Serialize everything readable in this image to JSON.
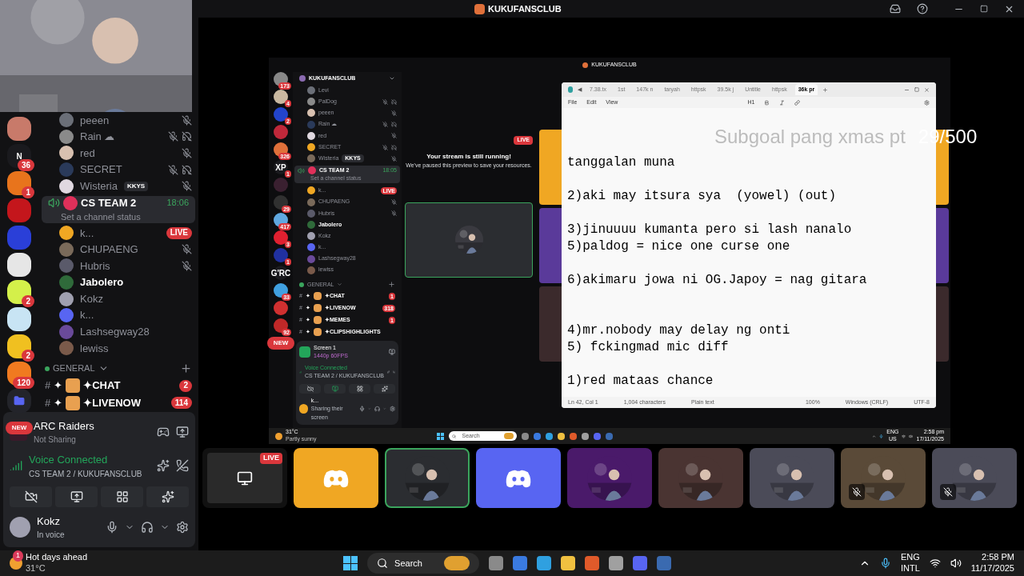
{
  "window": {
    "title": "KUKUFANSCLUB"
  },
  "outer": {
    "rail": [
      {
        "kind": "icon",
        "color": "#c87a6a"
      },
      {
        "kind": "text",
        "label": "N",
        "badge": "36"
      },
      {
        "kind": "icon",
        "color": "#e8741c",
        "badge": "1"
      },
      {
        "kind": "icon",
        "color": "#c4161c"
      },
      {
        "kind": "icon",
        "color": "#2a3fd8"
      },
      {
        "kind": "icon",
        "color": "#e6e6e6"
      },
      {
        "kind": "icon",
        "color": "#d4f04a",
        "badge": "2"
      },
      {
        "kind": "icon",
        "color": "#c8e4f4"
      },
      {
        "kind": "icon",
        "color": "#f0c020",
        "badge": "2"
      },
      {
        "kind": "icon",
        "color": "#f07a20",
        "badge": "120"
      },
      {
        "kind": "folder"
      },
      {
        "kind": "new",
        "label": "NEW"
      }
    ],
    "members_above": [
      {
        "name": "peeen",
        "muted": true,
        "deafened": false,
        "speaking": false,
        "live": false
      },
      {
        "name": "Rain ☁",
        "muted": true,
        "deafened": true,
        "speaking": false,
        "live": false
      },
      {
        "name": "red",
        "muted": true,
        "deafened": false,
        "speaking": false,
        "live": false
      },
      {
        "name": "SECRET",
        "muted": true,
        "deafened": true,
        "speaking": false,
        "live": false
      },
      {
        "name": "Wisteria",
        "tag": "KKYS",
        "muted": true,
        "deafened": false,
        "speaking": false,
        "live": false
      }
    ],
    "voice_channel": {
      "name": "CS TEAM 2",
      "timer": "18:06",
      "status": "Set a channel status"
    },
    "voice_members": [
      {
        "name": "k...",
        "muted": false,
        "deafened": false,
        "speaking": false,
        "live": true,
        "live_label": "LIVE"
      },
      {
        "name": "CHUPAENG",
        "muted": true,
        "deafened": false,
        "speaking": false,
        "live": false
      },
      {
        "name": "Hubris",
        "muted": true,
        "deafened": false,
        "speaking": false,
        "live": false
      },
      {
        "name": "Jabolero",
        "muted": false,
        "deafened": false,
        "speaking": true,
        "live": false
      },
      {
        "name": "Kokz",
        "muted": false,
        "deafened": false,
        "speaking": false,
        "live": false
      },
      {
        "name": "k...",
        "muted": false,
        "deafened": false,
        "speaking": false,
        "live": false
      },
      {
        "name": "Lashsegway28",
        "muted": false,
        "deafened": false,
        "speaking": false,
        "live": false
      },
      {
        "name": "lewiss",
        "muted": false,
        "deafened": false,
        "speaking": false,
        "live": false
      }
    ],
    "category": "GENERAL",
    "channels": [
      {
        "symbol": "#",
        "prefix": "✦",
        "name": "✦CHAT",
        "badge": "2"
      },
      {
        "symbol": "#",
        "prefix": "✦",
        "name": "✦LIVENOW",
        "badge": "114"
      }
    ],
    "activity": {
      "title": "ARC Raiders",
      "subtitle": "Not Sharing"
    },
    "voice": {
      "label": "Voice Connected",
      "channel": "CS TEAM 2 / KUKUFANSCLUB"
    },
    "user": {
      "name": "Kokz",
      "status": "In voice"
    }
  },
  "tiles": [
    {
      "kind": "stream",
      "live_label": "LIVE",
      "selected": false
    },
    {
      "kind": "discord",
      "color": "#f0a723",
      "selected": false
    },
    {
      "kind": "picture",
      "color": "#2b2d31",
      "selected": true
    },
    {
      "kind": "discord",
      "color": "#5865f2",
      "selected": false
    },
    {
      "kind": "picture",
      "color": "#4a1a6a",
      "selected": false
    },
    {
      "kind": "picture",
      "color": "#4a3432",
      "selected": false
    },
    {
      "kind": "picture",
      "color": "#4b4b58",
      "selected": false
    },
    {
      "kind": "picture",
      "color": "#5a4a38",
      "selected": false,
      "muted": true
    },
    {
      "kind": "picture",
      "color": "#4b4b58",
      "selected": false,
      "muted": true
    }
  ],
  "overlay": {
    "title": "Subgoal pang xmas pt",
    "count": "29/500"
  },
  "stream": {
    "title": "KUKUFANSCLUB",
    "nested": {
      "server": "KUKUFANSCLUB",
      "rail": [
        {
          "kind": "icon",
          "color": "#888888",
          "badge": "173"
        },
        {
          "kind": "icon",
          "color": "#c9b8a0",
          "badge": "4"
        },
        {
          "kind": "icon",
          "color": "#2244cc",
          "badge": "2"
        },
        {
          "kind": "icon",
          "color": "#c0283a"
        },
        {
          "kind": "icon",
          "color": "#e0703a",
          "badge": "326"
        },
        {
          "kind": "text",
          "label": "XP",
          "badge": "1"
        },
        {
          "kind": "icon",
          "color": "#3a2030"
        },
        {
          "kind": "icon",
          "color": "#303030",
          "badge": "29"
        },
        {
          "kind": "icon",
          "color": "#60a8e0",
          "badge": "417"
        },
        {
          "kind": "icon",
          "color": "#e02030",
          "badge": "3"
        },
        {
          "kind": "icon",
          "color": "#2030a0",
          "badge": "1"
        },
        {
          "kind": "text",
          "label": "G'RC"
        },
        {
          "kind": "icon",
          "color": "#40a0e0",
          "badge": "33"
        },
        {
          "kind": "icon",
          "color": "#d03030"
        },
        {
          "kind": "icon",
          "color": "#c02828",
          "badge": "92"
        },
        {
          "kind": "new",
          "label": "NEW"
        }
      ],
      "members_above": [
        {
          "name": "Levi",
          "muted": false,
          "deafened": false,
          "speaking": false,
          "live": false
        },
        {
          "name": "PalDog",
          "muted": true,
          "deafened": true,
          "speaking": false,
          "live": false
        },
        {
          "name": "peeen",
          "muted": true,
          "deafened": false,
          "speaking": false,
          "live": false
        },
        {
          "name": "Rain ☁",
          "muted": true,
          "deafened": true,
          "speaking": false,
          "live": false
        },
        {
          "name": "red",
          "muted": true,
          "deafened": false,
          "speaking": false,
          "live": false
        },
        {
          "name": "SECRET",
          "muted": true,
          "deafened": true,
          "speaking": false,
          "live": false
        },
        {
          "name": "Wisteria",
          "tag": "KKYS",
          "muted": true,
          "deafened": false,
          "speaking": false,
          "live": false
        }
      ],
      "voice_channel": {
        "name": "CS TEAM 2",
        "timer": "18:05",
        "status": "Set a channel status"
      },
      "voice_members": [
        {
          "name": "k...",
          "muted": false,
          "deafened": false,
          "speaking": false,
          "live": true,
          "live_label": "LIVE"
        },
        {
          "name": "CHUPAENG",
          "muted": true,
          "deafened": false,
          "speaking": false,
          "live": false
        },
        {
          "name": "Hubris",
          "muted": true,
          "deafened": false,
          "speaking": false,
          "live": false
        },
        {
          "name": "Jabolero",
          "muted": false,
          "deafened": false,
          "speaking": true,
          "live": false
        },
        {
          "name": "Kokz",
          "muted": false,
          "deafened": false,
          "speaking": false,
          "live": false
        },
        {
          "name": "k...",
          "muted": false,
          "deafened": false,
          "speaking": false,
          "live": false
        },
        {
          "name": "Lashsegway28",
          "muted": false,
          "deafened": false,
          "speaking": false,
          "live": false
        },
        {
          "name": "lewiss",
          "muted": false,
          "deafened": false,
          "speaking": false,
          "live": false
        }
      ],
      "category": "GENERAL",
      "channels": [
        {
          "symbol": "#",
          "prefix": "✦",
          "name": "✦CHAT",
          "badge": "1"
        },
        {
          "symbol": "#",
          "prefix": "✦",
          "name": "✦LIVENOW",
          "badge": "318"
        },
        {
          "symbol": "#",
          "prefix": "✦",
          "name": "✦MEMES",
          "badge": "1"
        },
        {
          "symbol": "#",
          "prefix": "✦",
          "name": "✦CLIPSHIGHLIGHTS"
        }
      ],
      "activity": {
        "title": "Screen 1",
        "subtitle": "1440p 60FPS"
      },
      "voice": {
        "label": "Voice Connected",
        "channel": "CS TEAM 2 / KUKUFANSCLUB"
      },
      "user": {
        "name": "k...",
        "status": "Sharing their screen"
      }
    },
    "preview": {
      "live_label": "LIVE",
      "title": "Your stream is still running!",
      "body": "We've paused this preview to save your resources."
    },
    "notepad": {
      "scroll_left": "◀",
      "tabs": [
        {
          "label": "7.38.tx",
          "selected": false
        },
        {
          "label": "1st",
          "selected": false
        },
        {
          "label": "147k n",
          "selected": false
        },
        {
          "label": "taryah",
          "selected": false
        },
        {
          "label": "httpsk",
          "selected": false
        },
        {
          "label": "39.5k j",
          "selected": false
        },
        {
          "label": "Untitle",
          "selected": false
        },
        {
          "label": "httpsk",
          "selected": false
        },
        {
          "label": "36k pr",
          "selected": true
        }
      ],
      "menu": [
        "File",
        "Edit",
        "View"
      ],
      "heading": "H1",
      "lines": [
        {
          "kind": "line",
          "text": "tanggalan muna"
        },
        {
          "kind": "blank"
        },
        {
          "kind": "line",
          "text": "2)aki may itsura sya  (yowel) (out)"
        },
        {
          "kind": "blank"
        },
        {
          "kind": "line",
          "text": "3)jinuuuu kumanta pero si lash nanalo"
        },
        {
          "kind": "line",
          "text": "5)paldog = nice one curse one"
        },
        {
          "kind": "blank"
        },
        {
          "kind": "line",
          "text": "6)akimaru jowa ni OG.Japoy = nag gitara"
        },
        {
          "kind": "blank"
        },
        {
          "kind": "blank"
        },
        {
          "kind": "line",
          "text": "4)mr.nobody may delay ng onti"
        },
        {
          "kind": "line",
          "text": "5) fckingmad mic diff"
        },
        {
          "kind": "blank"
        },
        {
          "kind": "line",
          "text": "1)red mataas chance"
        }
      ],
      "status": [
        "Ln 42, Col 1",
        "1,004 characters",
        "Plain text",
        "100%",
        "Windows (CRLF)",
        "UTF-8"
      ]
    },
    "taskbar": {
      "temp": "31°C",
      "weather": "Partly sunny",
      "search": "Search",
      "lang": [
        "ENG",
        "US"
      ],
      "time": "2:58 pm",
      "date": "17/11/2025"
    }
  },
  "taskbar": {
    "alert": "1",
    "weather": "Hot days ahead",
    "temp": "31°C",
    "search": "Search",
    "lang": [
      "ENG",
      "INTL"
    ],
    "time": "2:58 PM",
    "date": "11/17/2025"
  }
}
